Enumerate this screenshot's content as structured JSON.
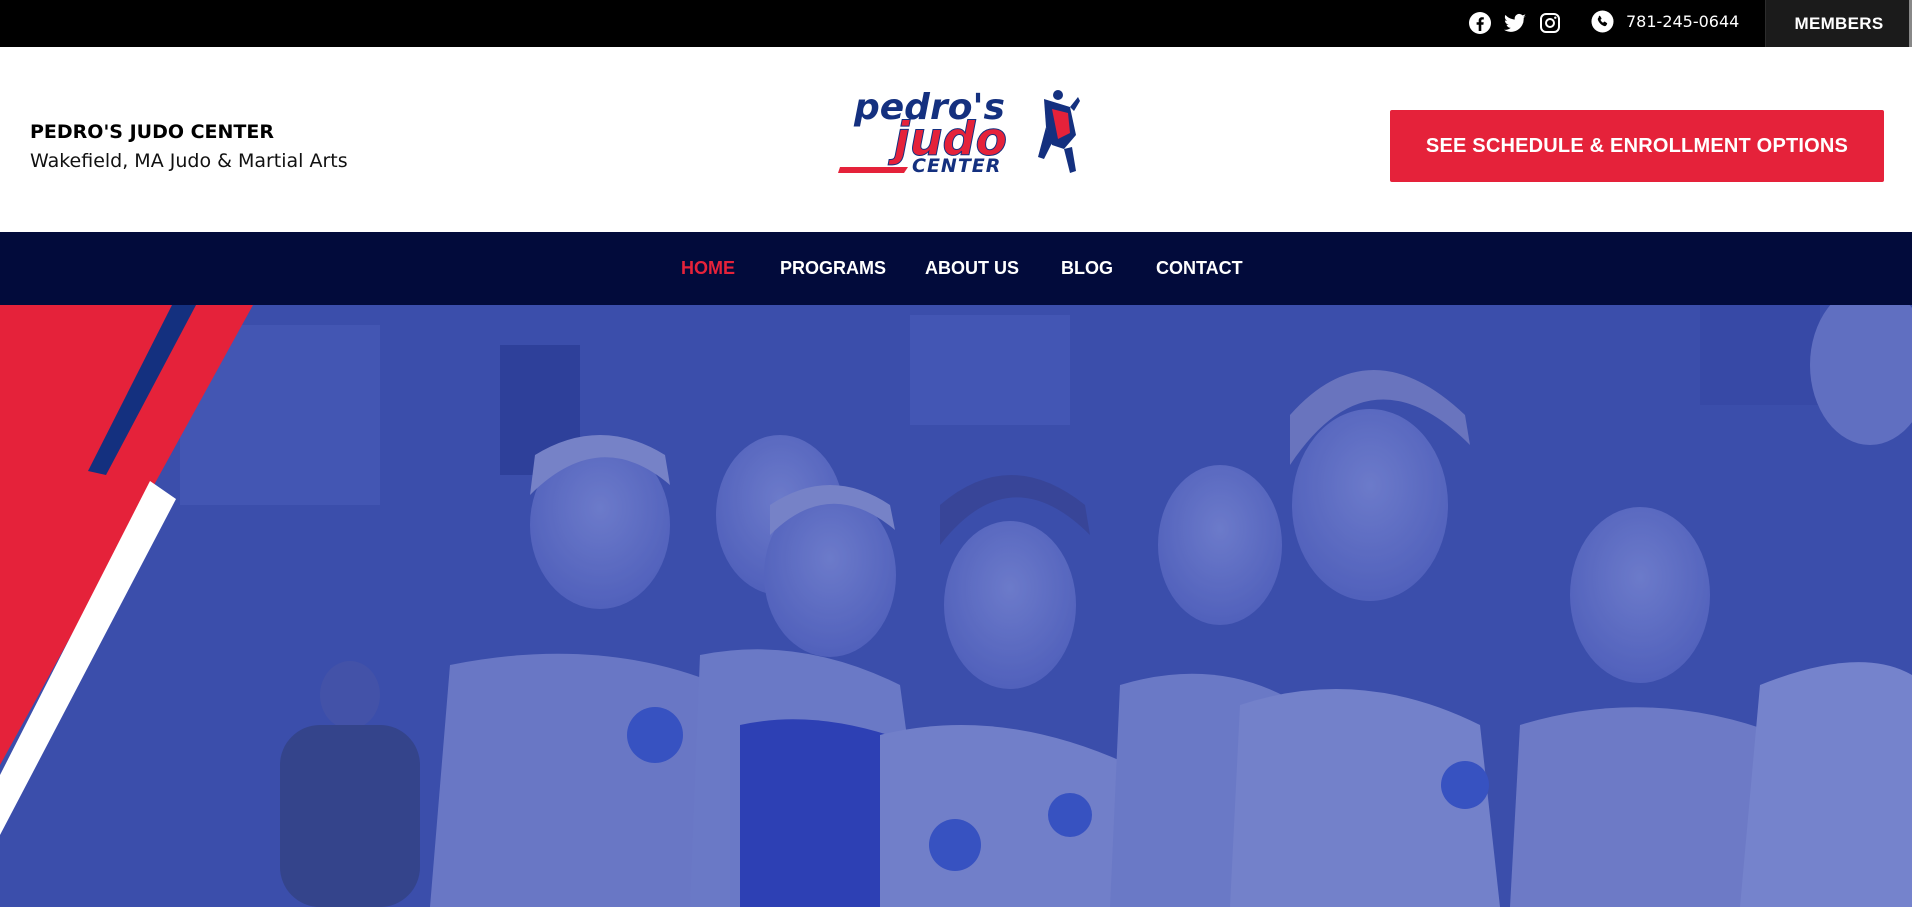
{
  "topbar": {
    "social_icons": [
      "facebook-icon",
      "twitter-icon",
      "instagram-icon"
    ],
    "phone_icon": "phone-icon",
    "phone": "781-245-0644",
    "members_label": "MEMBERS"
  },
  "header": {
    "site_name": "PEDRO'S JUDO CENTER",
    "tagline": "Wakefield, MA Judo & Martial Arts",
    "logo": {
      "line1": "pedro's",
      "line2": "judo",
      "line3": "CENTER"
    },
    "cta_label": "SEE SCHEDULE & ENROLLMENT OPTIONS"
  },
  "nav": {
    "items": [
      {
        "label": "HOME",
        "active": true
      },
      {
        "label": "PROGRAMS",
        "active": false
      },
      {
        "label": "ABOUT US",
        "active": false
      },
      {
        "label": "BLOG",
        "active": false
      },
      {
        "label": "CONTACT",
        "active": false
      }
    ]
  },
  "colors": {
    "brand_red": "#e5223a",
    "brand_navy": "#020b3b",
    "logo_blue": "#14307f",
    "hero_overlay": "#3d4fa6"
  }
}
